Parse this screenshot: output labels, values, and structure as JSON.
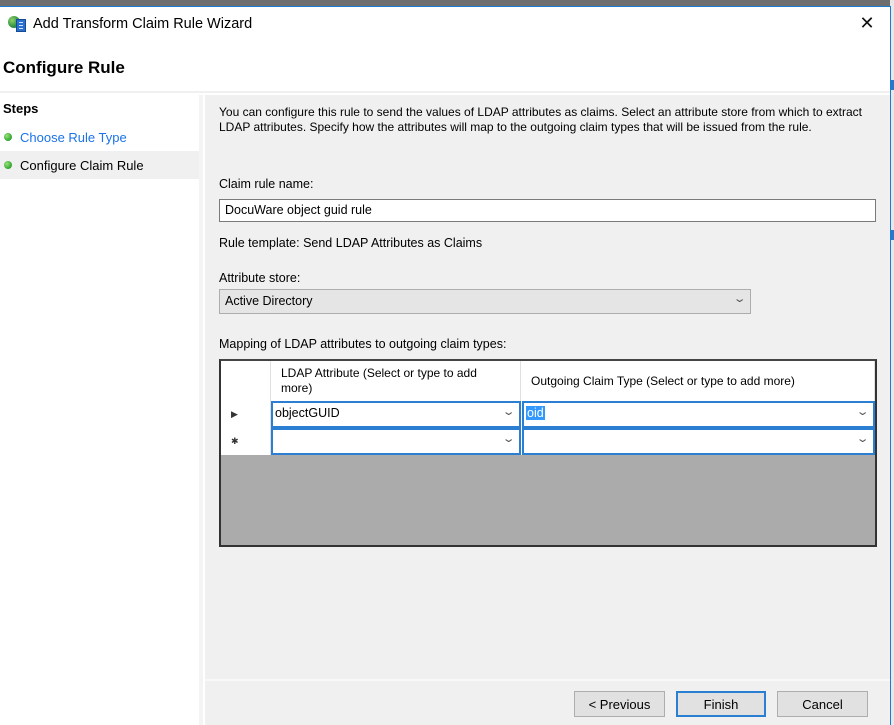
{
  "window": {
    "title": "Add Transform Claim Rule Wizard",
    "close_glyph": "✕",
    "icon": "wizard-app-icon"
  },
  "header": {
    "title": "Configure Rule"
  },
  "steps": {
    "title": "Steps",
    "items": [
      {
        "label": "Choose Rule Type",
        "state": "link"
      },
      {
        "label": "Configure Claim Rule",
        "state": "active"
      }
    ]
  },
  "content": {
    "description": "You can configure this rule to send the values of LDAP attributes as claims. Select an attribute store from which to extract LDAP attributes. Specify how the attributes will map to the outgoing claim types that will be issued from the rule.",
    "claim_rule_name_label": "Claim rule name:",
    "claim_rule_name_value": "DocuWare object guid rule",
    "rule_template": "Rule template: Send LDAP Attributes as Claims",
    "attribute_store_label": "Attribute store:",
    "attribute_store_value": "Active Directory",
    "mapping_label": "Mapping of LDAP attributes to outgoing claim types:",
    "grid": {
      "columns": [
        "LDAP Attribute (Select or type to add more)",
        "Outgoing Claim Type (Select or type to add more)"
      ],
      "rows": [
        {
          "indicator": "▶",
          "ldap": "objectGUID",
          "claim": "oid"
        },
        {
          "indicator": "✱",
          "ldap": "",
          "claim": ""
        }
      ]
    }
  },
  "footer": {
    "previous": "< Previous",
    "finish": "Finish",
    "cancel": "Cancel"
  },
  "colors": {
    "accent": "#2a7fd3",
    "link": "#1a73e8",
    "panel_bg": "#f0f0f0",
    "grid_empty": "#ababab"
  }
}
